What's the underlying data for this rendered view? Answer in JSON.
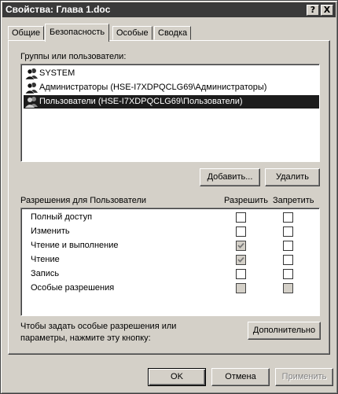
{
  "window": {
    "title": "Свойства: Глава 1.doc",
    "help_label": "?",
    "close_label": "X"
  },
  "tabs": [
    {
      "label": "Общие"
    },
    {
      "label": "Безопасность"
    },
    {
      "label": "Особые"
    },
    {
      "label": "Сводка"
    }
  ],
  "groups": {
    "label": "Группы или пользователи:",
    "items": [
      {
        "label": "SYSTEM",
        "icon": "users-group-icon"
      },
      {
        "label": "Администраторы (HSE-I7XDPQCLG69\\Администраторы)",
        "icon": "users-group-icon"
      },
      {
        "label": "Пользователи (HSE-I7XDPQCLG69\\Пользователи)",
        "icon": "users-group-icon",
        "selected": true
      }
    ],
    "add_button": "Добавить...",
    "remove_button": "Удалить"
  },
  "permissions": {
    "label": "Разрешения для Пользователи",
    "allow_header": "Разрешить",
    "deny_header": "Запретить",
    "rows": [
      {
        "label": "Полный доступ",
        "allow": "unchecked",
        "deny": "unchecked"
      },
      {
        "label": "Изменить",
        "allow": "unchecked",
        "deny": "unchecked"
      },
      {
        "label": "Чтение и выполнение",
        "allow": "checked-disabled",
        "deny": "unchecked"
      },
      {
        "label": "Чтение",
        "allow": "checked-disabled",
        "deny": "unchecked"
      },
      {
        "label": "Запись",
        "allow": "unchecked",
        "deny": "unchecked"
      },
      {
        "label": "Особые разрешения",
        "allow": "disabled",
        "deny": "disabled"
      }
    ]
  },
  "advanced": {
    "text_line1": "Чтобы задать особые разрешения или",
    "text_line2": "параметры, нажмите эту кнопку:",
    "button": "Дополнительно"
  },
  "footer": {
    "ok": "OK",
    "cancel": "Отмена",
    "apply": "Применить"
  },
  "colors": {
    "face": "#d4d0c8",
    "titlebar": "#3a3a3a",
    "selection": "#1c1c1c"
  }
}
